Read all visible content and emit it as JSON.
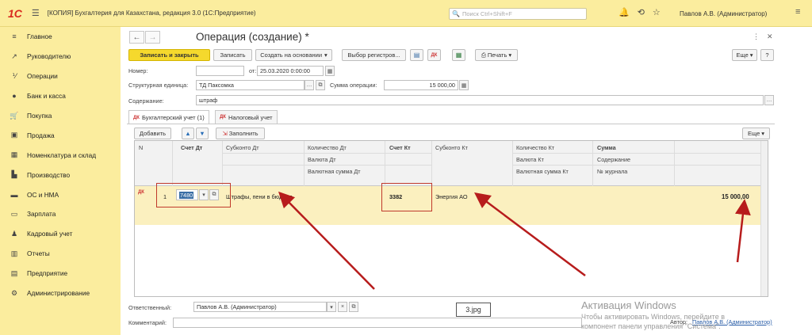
{
  "topbar": {
    "logo": "1С",
    "title": "[КОПИЯ] Бухгалтерия для Казахстана, редакция 3.0 (1С:Предприятие)",
    "search_placeholder": "Поиск Ctrl+Shift+F",
    "user": "Павлов А.В. (Администратор)"
  },
  "sidebar": {
    "items": [
      {
        "icon": "≡",
        "label": "Главное"
      },
      {
        "icon": "↗",
        "label": "Руководителю"
      },
      {
        "icon": "⅟",
        "label": "Операции"
      },
      {
        "icon": "●",
        "label": "Банк и касса"
      },
      {
        "icon": "🛒",
        "label": "Покупка"
      },
      {
        "icon": "▣",
        "label": "Продажа"
      },
      {
        "icon": "▦",
        "label": "Номенклатура и склад"
      },
      {
        "icon": "▙",
        "label": "Производство"
      },
      {
        "icon": "▬",
        "label": "ОС и НМА"
      },
      {
        "icon": "▭",
        "label": "Зарплата"
      },
      {
        "icon": "♟",
        "label": "Кадровый учет"
      },
      {
        "icon": "▥",
        "label": "Отчеты"
      },
      {
        "icon": "▤",
        "label": "Предприятие"
      },
      {
        "icon": "⚙",
        "label": "Администрирование"
      }
    ]
  },
  "form": {
    "title": "Операция (создание) *",
    "toolbar": {
      "save_close": "Записать и закрыть",
      "save": "Записать",
      "create_based": "Создать на основании",
      "registers": "Выбор регистров...",
      "print": "Печать",
      "more": "Еще",
      "help": "?"
    },
    "number_label": "Номер:",
    "number_value": "",
    "date_label": "от:",
    "date_value": "25.03.2020 0:00:00",
    "unit_label": "Структурная единица:",
    "unit_value": "ТД Паксомка",
    "sum_label": "Сумма операции:",
    "sum_value": "15 000,00",
    "content_label": "Содержание:",
    "content_value": "штраф",
    "tabs": [
      {
        "label": "Бухгалтерский учет (1)"
      },
      {
        "label": "Налоговый учет"
      }
    ],
    "table_toolbar": {
      "add": "Добавить",
      "fill": "Заполнить",
      "more": "Еще"
    },
    "table": {
      "headers": {
        "n": "N",
        "acc_dt": "Счет Дт",
        "subconto_dt": "Субконто Дт",
        "qty_dt": "Количество Дт",
        "cur_dt": "Валюта Дт",
        "cur_sum_dt": "Валютная сумма Дт",
        "acc_kt": "Счет Кт",
        "subconto_kt": "Субконто Кт",
        "qty_kt": "Количество Кт",
        "cur_kt": "Валюта Кт",
        "cur_sum_kt": "Валютная сумма Кт",
        "sum": "Сумма",
        "content": "Содержание",
        "journal": "№ журнала"
      },
      "rows": [
        {
          "n": "1",
          "acc_dt": "7480",
          "subconto_dt": "Штрафы, пени в бюджет",
          "acc_kt": "3382",
          "subconto_kt": "Энергия АО",
          "sum": "15 000,00"
        }
      ]
    },
    "responsible_label": "Ответственный:",
    "responsible_value": "Павлов А.В. (Администратор)",
    "comment_label": "Комментарий:",
    "comment_value": "",
    "author_label": "Автор:",
    "author_value": "Павлов А.В. (Администратор)"
  },
  "overlay": {
    "file_label": "3.jpg",
    "watermark_title": "Активация Windows",
    "watermark_line1": "Чтобы активировать Windows, перейдите в",
    "watermark_line2": "компонент панели управления \"Система\"."
  },
  "colors": {
    "header_bg": "#fbed9e",
    "primary_button": "#f5d92d",
    "selected_row": "#fbf0bf",
    "annotation": "#c0392b"
  }
}
